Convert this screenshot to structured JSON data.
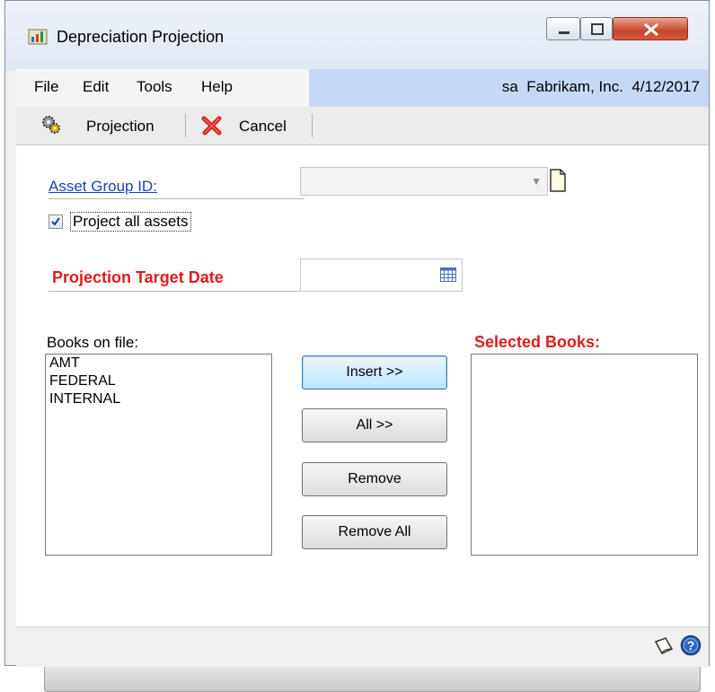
{
  "window": {
    "title": "Depreciation Projection"
  },
  "menu": {
    "items": [
      "File",
      "Edit",
      "Tools",
      "Help"
    ],
    "user_info": "sa  Fabrikam, Inc.  4/12/2017"
  },
  "toolbar": {
    "projection_label": "Projection",
    "cancel_label": "Cancel"
  },
  "form": {
    "asset_group_label": "Asset Group ID:",
    "asset_group_value": "",
    "project_all_label": "Project all assets",
    "project_all_checked": true,
    "target_date_label": "Projection Target Date",
    "target_date_value": ""
  },
  "books": {
    "on_file_label": "Books on file:",
    "on_file": [
      "AMT",
      "FEDERAL",
      "INTERNAL"
    ],
    "selected_label": "Selected Books:",
    "selected": []
  },
  "buttons": {
    "insert": "Insert >>",
    "all": "All >>",
    "remove": "Remove",
    "remove_all": "Remove All"
  },
  "progress": {
    "value": 0
  },
  "colors": {
    "required_label": "#e01b1b",
    "link": "#1f3fbd",
    "user_info_bg": "#c7d8f5"
  },
  "icons": {
    "projection": "gears-icon",
    "cancel": "red-x-icon",
    "note": "note-icon",
    "calendar": "calendar-icon",
    "status_note": "note-icon",
    "help": "help-icon"
  }
}
